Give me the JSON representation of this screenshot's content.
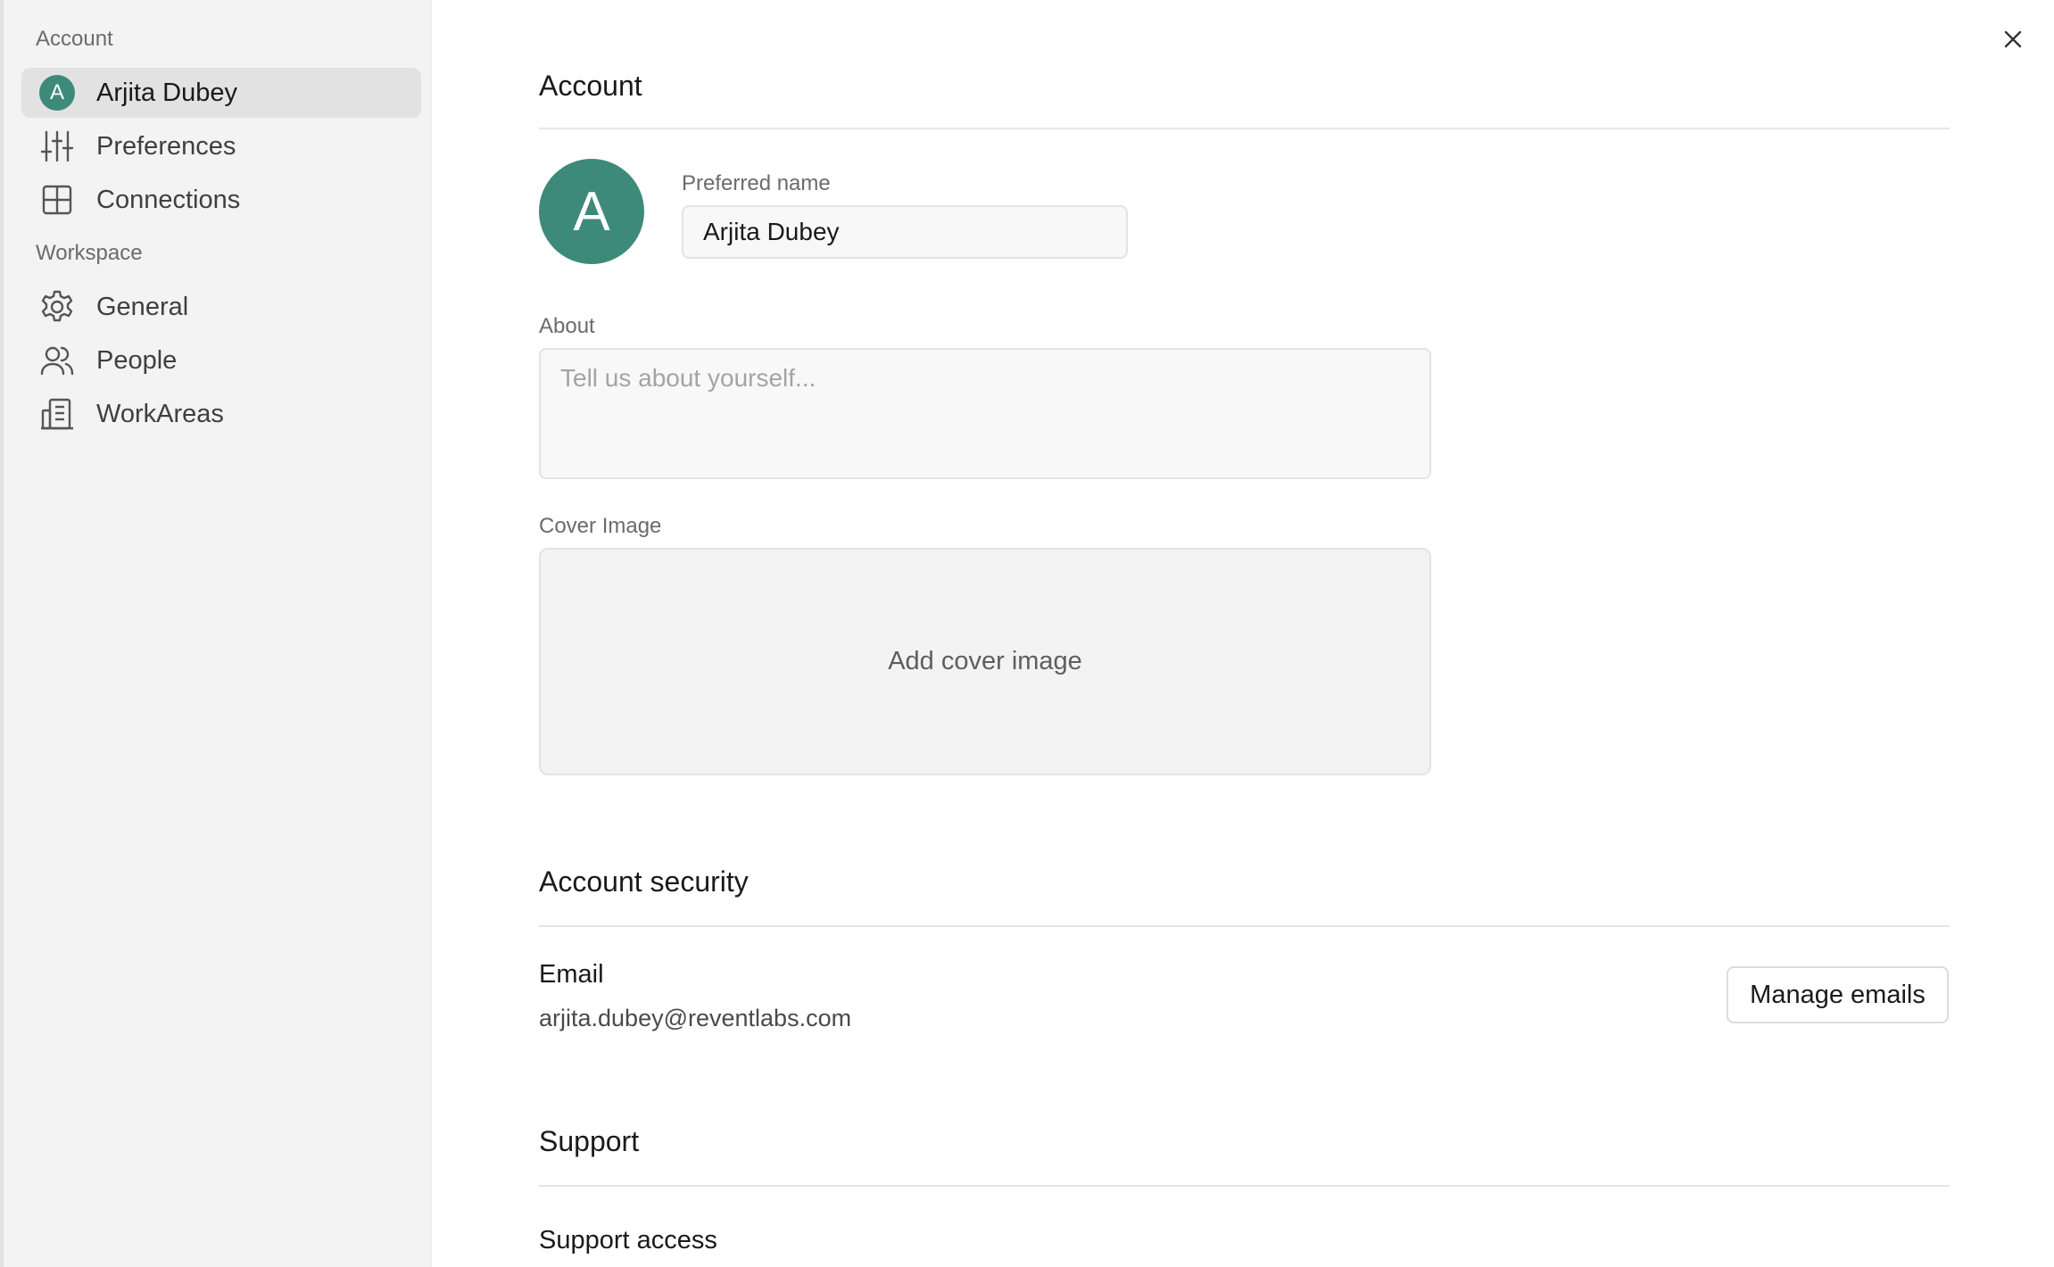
{
  "sidebar": {
    "account_section": "Account",
    "workspace_section": "Workspace",
    "items": [
      {
        "label": "Arjita Dubey",
        "avatar_letter": "A",
        "active": true
      },
      {
        "label": "Preferences",
        "icon": "sliders-icon"
      },
      {
        "label": "Connections",
        "icon": "grid-icon"
      },
      {
        "label": "General",
        "icon": "gear-icon"
      },
      {
        "label": "People",
        "icon": "people-icon"
      },
      {
        "label": "WorkAreas",
        "icon": "building-icon"
      }
    ]
  },
  "account": {
    "title": "Account",
    "avatar_letter": "A",
    "preferred_name_label": "Preferred name",
    "preferred_name_value": "Arjita Dubey",
    "about_label": "About",
    "about_placeholder": "Tell us about yourself...",
    "cover_label": "Cover Image",
    "cover_action": "Add cover image"
  },
  "security": {
    "title": "Account security",
    "email_label": "Email",
    "email_value": "arjita.dubey@reventlabs.com",
    "manage_button": "Manage emails"
  },
  "support": {
    "title": "Support",
    "access_label": "Support access"
  },
  "colors": {
    "avatar": "#3d8a7a",
    "sidebar_bg": "#f3f3f3",
    "active_item_bg": "#e2e2e2"
  }
}
